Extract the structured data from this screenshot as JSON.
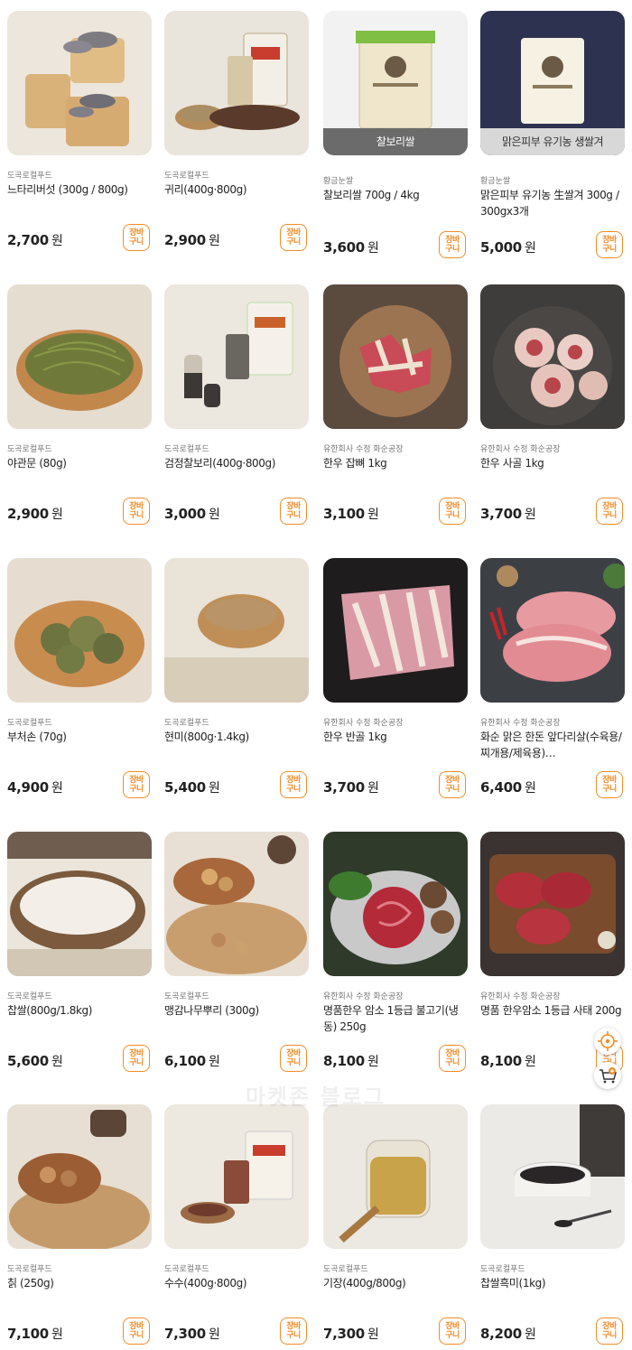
{
  "currency": "원",
  "cart_label_top": "장바",
  "cart_label_bottom": "구니",
  "watermark": "마켓존 블로그",
  "products": [
    {
      "seller": "도곡로컬푸드",
      "name": "느타리버섯 (300g / 800g)",
      "price": "2,700",
      "thumb": "mushroom",
      "band": ""
    },
    {
      "seller": "도곡로컬푸드",
      "name": "귀리(400g·800g)",
      "price": "2,900",
      "thumb": "grain",
      "band": ""
    },
    {
      "seller": "황금눈쌀",
      "name": "찰보리쌀 700g / 4kg",
      "price": "3,600",
      "thumb": "ricebag_green",
      "band": "찰보리쌀"
    },
    {
      "seller": "황금눈쌀",
      "name": "맑은피부 유기농 生쌀겨 300g / 300gx3개",
      "price": "5,000",
      "thumb": "ricebag_navy",
      "band": "맑은피부 유기농 생쌀겨"
    },
    {
      "seller": "도곡로컬푸드",
      "name": "야관문 (80g)",
      "price": "2,900",
      "thumb": "herb",
      "band": ""
    },
    {
      "seller": "도곡로컬푸드",
      "name": "검정찰보리(400g·800g)",
      "price": "3,000",
      "thumb": "blackgrain",
      "band": ""
    },
    {
      "seller": "유한회사 수정 화순공장",
      "name": "한우 잡뼈 1kg",
      "price": "3,100",
      "thumb": "bones",
      "band": ""
    },
    {
      "seller": "유한회사 수정 화순공장",
      "name": "한우 사골 1kg",
      "price": "3,700",
      "thumb": "marrow",
      "band": ""
    },
    {
      "seller": "도곡로컬푸드",
      "name": "부처손 (70g)",
      "price": "4,900",
      "thumb": "moss",
      "band": ""
    },
    {
      "seller": "도곡로컬푸드",
      "name": "현미(800g·1.4kg)",
      "price": "5,400",
      "thumb": "brownrice",
      "band": ""
    },
    {
      "seller": "유한회사 수정 화순공장",
      "name": "한우 반골 1kg",
      "price": "3,700",
      "thumb": "ribs",
      "band": ""
    },
    {
      "seller": "유한회사 수정 화순공장",
      "name": "화순 맑은 한돈 앞다리살(수육용/찌개용/제육용)…",
      "price": "6,400",
      "thumb": "pork",
      "band": ""
    },
    {
      "seller": "도곡로컬푸드",
      "name": "찹쌀(800g/1.8kg)",
      "price": "5,600",
      "thumb": "whiterice",
      "band": ""
    },
    {
      "seller": "도곡로컬푸드",
      "name": "맹감나무뿌리 (300g)",
      "price": "6,100",
      "thumb": "rootslices",
      "band": ""
    },
    {
      "seller": "유한회사 수정 화순공장",
      "name": "명품한우 암소 1등급 불고기(냉동) 250g",
      "price": "8,100",
      "thumb": "bulgogi",
      "band": ""
    },
    {
      "seller": "유한회사 수정 화순공장",
      "name": "명품 한우암소 1등급 사태 200g",
      "price": "8,100",
      "thumb": "shank",
      "band": ""
    },
    {
      "seller": "도곡로컬푸드",
      "name": "칡 (250g)",
      "price": "7,100",
      "thumb": "arrowroot",
      "band": ""
    },
    {
      "seller": "도곡로컬푸드",
      "name": "수수(400g·800g)",
      "price": "7,300",
      "thumb": "sorghum",
      "band": ""
    },
    {
      "seller": "도곡로컬푸드",
      "name": "기장(400g/800g)",
      "price": "7,300",
      "thumb": "millet",
      "band": ""
    },
    {
      "seller": "도곡로컬푸드",
      "name": "찹쌀흑미(1kg)",
      "price": "8,200",
      "thumb": "blackrice",
      "band": ""
    }
  ],
  "floating_buttons": [
    {
      "icon": "recent-view-icon"
    },
    {
      "icon": "cart-add-icon"
    }
  ]
}
